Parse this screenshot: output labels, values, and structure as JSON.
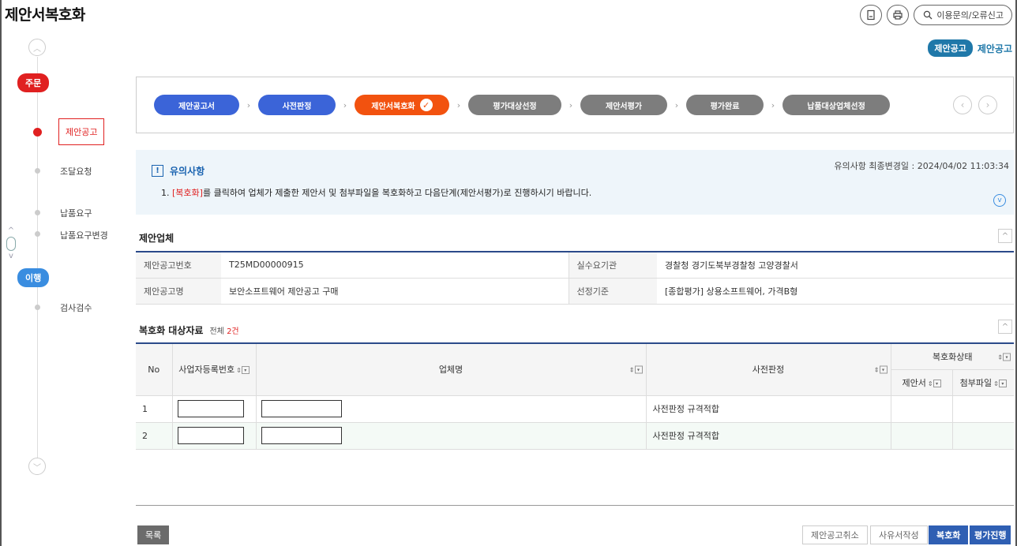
{
  "page": {
    "title": "제안서복호화"
  },
  "toolbar": {
    "inquiry_label": "이용문의/오류신고"
  },
  "stage": {
    "pill": "제안공고",
    "text": "제안공고"
  },
  "timeline": {
    "phase1": "주문",
    "phase2": "이행",
    "items": [
      "제안공고",
      "조달요청",
      "납품요구",
      "납품요구변경",
      "검사검수"
    ]
  },
  "steps": [
    "제안공고서",
    "사전판정",
    "제안서복호화",
    "평가대상선정",
    "제안서평가",
    "평가완료",
    "납품대상업체선정"
  ],
  "notice": {
    "title": "유의사항",
    "updated": "유의사항 최종변경일 : 2024/04/02 11:03:34",
    "line_prefix": "1. ",
    "line_highlight": "[복호화]",
    "line_rest": "를 클릭하여 업체가 제출한 제안서 및 첨부파일을 복호화하고 다음단계(제안서평가)로 진행하시기 바랍니다."
  },
  "company_section": {
    "title": "제안업체",
    "rows": [
      {
        "l1": "제안공고번호",
        "v1": "T25MD00000915",
        "l2": "실수요기관",
        "v2": "경찰청 경기도북부경찰청 고양경찰서"
      },
      {
        "l1": "제안공고명",
        "v1": "보안소프트웨어 제안공고 구매",
        "l2": "선정기준",
        "v2": "[종합평가] 상용소프트웨어, 가격B형"
      }
    ]
  },
  "target_section": {
    "title": "복호화 대상자료",
    "count_prefix": "전체 ",
    "count_value": "2건",
    "headers": {
      "no": "No",
      "bizno": "사업자등록번호",
      "company": "업체명",
      "prejudge": "사전판정",
      "status": "복호화상태",
      "proposal": "제안서",
      "attach": "첨부파일"
    },
    "rows": [
      {
        "no": "1",
        "prejudge": "사전판정 규격적합"
      },
      {
        "no": "2",
        "prejudge": "사전판정 규격적합"
      }
    ]
  },
  "buttons": {
    "list": "목록",
    "cancel": "제안공고취소",
    "reason": "사유서작성",
    "decrypt": "복호화",
    "evaluate": "평가진행"
  }
}
